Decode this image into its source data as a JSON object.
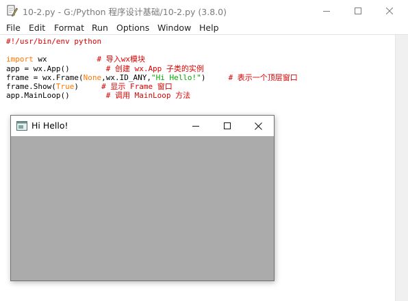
{
  "window": {
    "title": "10-2.py - G:/Python 程序设计基础/10-2.py (3.8.0)",
    "app_icon": "python-idle-icon",
    "controls": [
      "minimize-icon",
      "maximize-icon",
      "close-icon"
    ]
  },
  "menubar": {
    "items": [
      {
        "label": "File"
      },
      {
        "label": "Edit"
      },
      {
        "label": "Format"
      },
      {
        "label": "Run"
      },
      {
        "label": "Options"
      },
      {
        "label": "Window"
      },
      {
        "label": "Help"
      }
    ]
  },
  "editor": {
    "lines": [
      [
        {
          "t": "#!/usr/bin/env python",
          "c": "cm"
        }
      ],
      [],
      [
        {
          "t": "import",
          "c": "kw"
        },
        {
          "t": " wx           "
        },
        {
          "t": "# 导入wx模块",
          "c": "cm"
        }
      ],
      [
        {
          "t": "app = wx.App()        "
        },
        {
          "t": "# 创建 wx.App 子类的实例",
          "c": "cm"
        }
      ],
      [
        {
          "t": "frame = wx.Frame("
        },
        {
          "t": "None",
          "c": "kw"
        },
        {
          "t": ",wx.ID_ANY,"
        },
        {
          "t": "\"Hi Hello!\"",
          "c": "st"
        },
        {
          "t": ")     "
        },
        {
          "t": "# 表示一个顶层窗口",
          "c": "cm"
        }
      ],
      [
        {
          "t": "frame.Show("
        },
        {
          "t": "True",
          "c": "kw"
        },
        {
          "t": ")     "
        },
        {
          "t": "# 显示 Frame 窗口",
          "c": "cm"
        }
      ],
      [
        {
          "t": "app.MainLoop()        "
        },
        {
          "t": "# 调用 MainLoop 方法",
          "c": "cm"
        }
      ]
    ]
  },
  "frame": {
    "title": "Hi Hello!",
    "icon": "wx-frame-icon",
    "controls": [
      "minimize-icon",
      "maximize-icon",
      "close-icon"
    ],
    "client_color": "#ababab"
  },
  "colors": {
    "keyword": "#ff7700",
    "comment": "#dd0000",
    "string": "#00aa00"
  }
}
